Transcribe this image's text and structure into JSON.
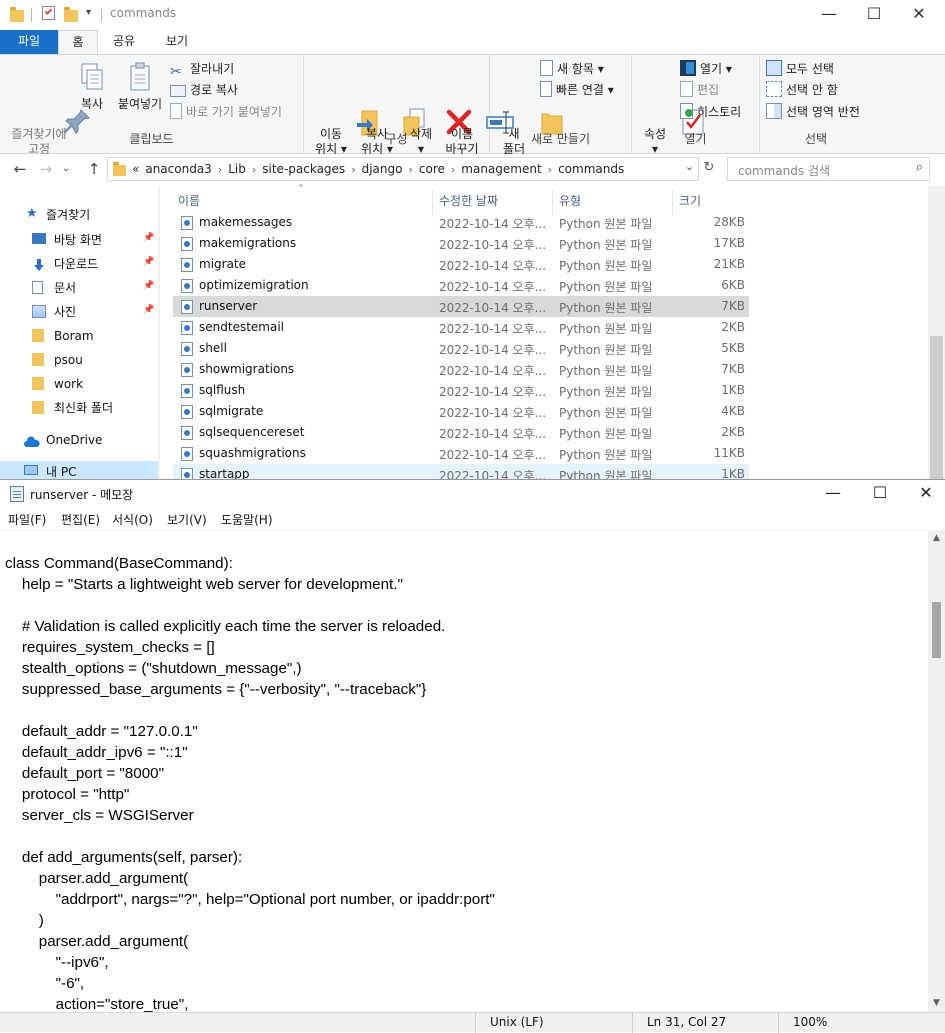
{
  "explorer": {
    "title": "commands",
    "tabs": {
      "file": "파일",
      "home": "홈",
      "share": "공유",
      "view": "보기"
    },
    "ribbon": {
      "clipboard": {
        "label": "클립보드",
        "pin": "즐겨찾기에\n고정",
        "copy": "복사",
        "paste": "붙여넣기",
        "cut": "잘라내기",
        "copy_path": "경로 복사",
        "paste_shortcut": "바로 가기 붙여넣기"
      },
      "organize": {
        "label": "구성",
        "move_to": "이동\n위치 ▾",
        "copy_to": "복사\n위치 ▾",
        "delete": "삭제\n▾",
        "rename": "이름\n바꾸기"
      },
      "new": {
        "label": "새로 만들기",
        "new_folder": "새\n폴더",
        "new_item": "새 항목 ▾",
        "easy_access": "빠른 연결 ▾"
      },
      "open": {
        "label": "열기",
        "properties": "속성\n▾",
        "open": "열기 ▾",
        "edit": "편집",
        "history": "히스토리"
      },
      "select": {
        "label": "선택",
        "select_all": "모두 선택",
        "select_none": "선택 안 함",
        "invert": "선택 영역 반전"
      }
    },
    "address": {
      "prefix": "«",
      "crumbs": [
        "anaconda3",
        "Lib",
        "site-packages",
        "django",
        "core",
        "management",
        "commands"
      ],
      "search_placeholder": "commands 검색"
    },
    "nav": {
      "quick_access": "즐겨찾기",
      "items": [
        "바탕 화면",
        "다운로드",
        "문서",
        "사진",
        "Boram",
        "psou",
        "work",
        "최신화 폴더"
      ],
      "onedrive": "OneDrive",
      "this_pc": "내 PC"
    },
    "columns": {
      "name": "이름",
      "modified": "수정한 날짜",
      "type": "유형",
      "size": "크기"
    },
    "files": [
      {
        "name": "makemessages",
        "date": "2022-10-14 오후...",
        "type": "Python 원본 파일",
        "size": "28KB"
      },
      {
        "name": "makemigrations",
        "date": "2022-10-14 오후...",
        "type": "Python 원본 파일",
        "size": "17KB"
      },
      {
        "name": "migrate",
        "date": "2022-10-14 오후...",
        "type": "Python 원본 파일",
        "size": "21KB"
      },
      {
        "name": "optimizemigration",
        "date": "2022-10-14 오후...",
        "type": "Python 원본 파일",
        "size": "6KB"
      },
      {
        "name": "runserver",
        "date": "2022-10-14 오후...",
        "type": "Python 원본 파일",
        "size": "7KB"
      },
      {
        "name": "sendtestemail",
        "date": "2022-10-14 오후...",
        "type": "Python 원본 파일",
        "size": "2KB"
      },
      {
        "name": "shell",
        "date": "2022-10-14 오후...",
        "type": "Python 원본 파일",
        "size": "5KB"
      },
      {
        "name": "showmigrations",
        "date": "2022-10-14 오후...",
        "type": "Python 원본 파일",
        "size": "7KB"
      },
      {
        "name": "sqlflush",
        "date": "2022-10-14 오후...",
        "type": "Python 원본 파일",
        "size": "1KB"
      },
      {
        "name": "sqlmigrate",
        "date": "2022-10-14 오후...",
        "type": "Python 원본 파일",
        "size": "4KB"
      },
      {
        "name": "sqlsequencereset",
        "date": "2022-10-14 오후...",
        "type": "Python 원본 파일",
        "size": "2KB"
      },
      {
        "name": "squashmigrations",
        "date": "2022-10-14 오후...",
        "type": "Python 원본 파일",
        "size": "11KB"
      },
      {
        "name": "startapp",
        "date": "2022-10-14 오후...",
        "type": "Python 원본 파일",
        "size": "1KB"
      }
    ],
    "selected_file": "runserver",
    "hover_file": "startapp"
  },
  "notepad": {
    "title": "runserver - 메모장",
    "menu": [
      "파일(F)",
      "편집(E)",
      "서식(O)",
      "보기(V)",
      "도움말(H)"
    ],
    "code": "class Command(BaseCommand):\n    help = \"Starts a lightweight web server for development.\"\n\n    # Validation is called explicitly each time the server is reloaded.\n    requires_system_checks = []\n    stealth_options = (\"shutdown_message\",)\n    suppressed_base_arguments = {\"--verbosity\", \"--traceback\"}\n\n    default_addr = \"127.0.0.1\"\n    default_addr_ipv6 = \"::1\"\n    default_port = \"8000\"\n    protocol = \"http\"\n    server_cls = WSGIServer\n\n    def add_arguments(self, parser):\n        parser.add_argument(\n            \"addrport\", nargs=\"?\", help=\"Optional port number, or ipaddr:port\"\n        )\n        parser.add_argument(\n            \"--ipv6\",\n            \"-6\",\n            action=\"store_true\",",
    "status": {
      "eol": "Unix (LF)",
      "position": "Ln 31, Col 27",
      "zoom": "100%"
    }
  },
  "colors": {
    "accent": "#1a6fc9",
    "selection": "#d9d9d9",
    "hover": "#e5f3ff"
  }
}
